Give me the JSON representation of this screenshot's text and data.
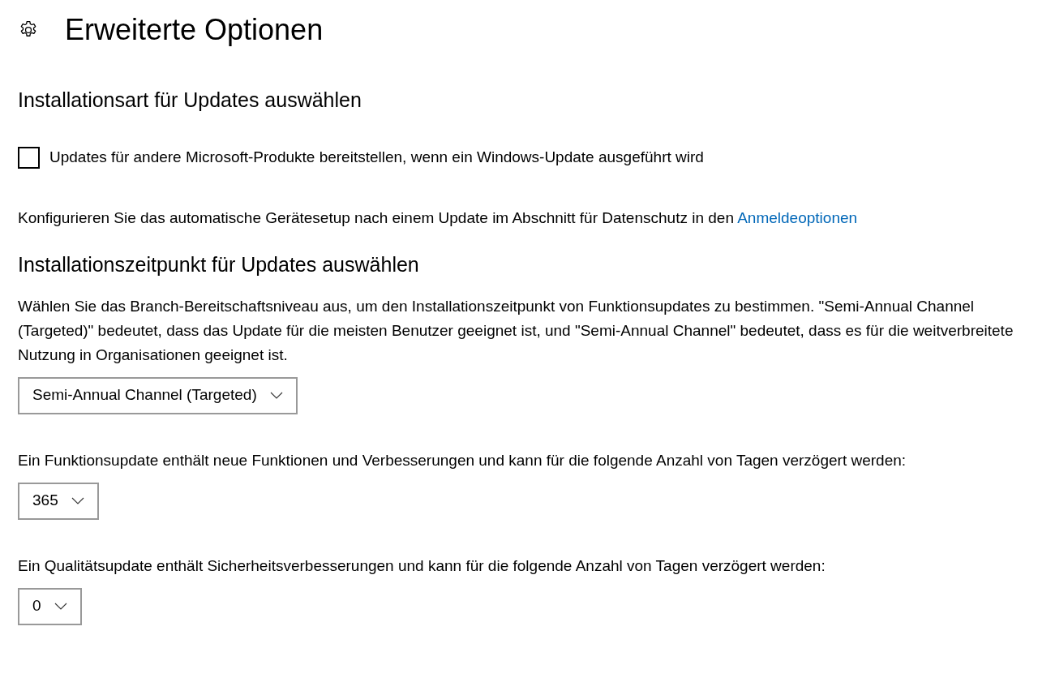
{
  "page": {
    "title": "Erweiterte Optionen"
  },
  "sections": [
    {
      "heading": "Installationsart für Updates auswählen",
      "items": [
        {
          "kind": "checkbox",
          "label": "Updates für andere Microsoft-Produkte bereitstellen, wenn ein Windows-Update ausgeführt wird",
          "checked": false
        },
        {
          "kind": "link_text",
          "text": "Konfigurieren Sie das automatische Gerätesetup nach einem Update im Abschnitt für Datenschutz in den ",
          "link": "Anmeldeoptionen"
        }
      ]
    },
    {
      "heading": "Installationszeitpunkt für Updates auswählen",
      "items": [
        {
          "kind": "paragraph",
          "text": "Wählen Sie das Branch-Bereitschaftsniveau aus, um den Installationszeitpunkt von Funktionsupdates zu bestimmen. \"Semi-Annual Channel (Targeted)\" bedeutet, dass das Update für die meisten Benutzer geeignet ist, und \"Semi-Annual Channel\" bedeutet, dass es für die weitverbreitete Nutzung in Organisationen geeignet ist."
        },
        {
          "kind": "dropdown",
          "value": "Semi-Annual Channel (Targeted)"
        },
        {
          "kind": "paragraph",
          "text": "Ein Funktionsupdate enthält neue Funktionen und Verbesserungen und kann für die folgende Anzahl von Tagen verzögert werden:"
        },
        {
          "kind": "dropdown",
          "value": "365"
        },
        {
          "kind": "paragraph",
          "text": "Ein Qualitätsupdate enthält Sicherheitsverbesserungen und kann für die folgende Anzahl von Tagen verzögert werden:"
        },
        {
          "kind": "dropdown",
          "value": "0"
        }
      ]
    }
  ]
}
